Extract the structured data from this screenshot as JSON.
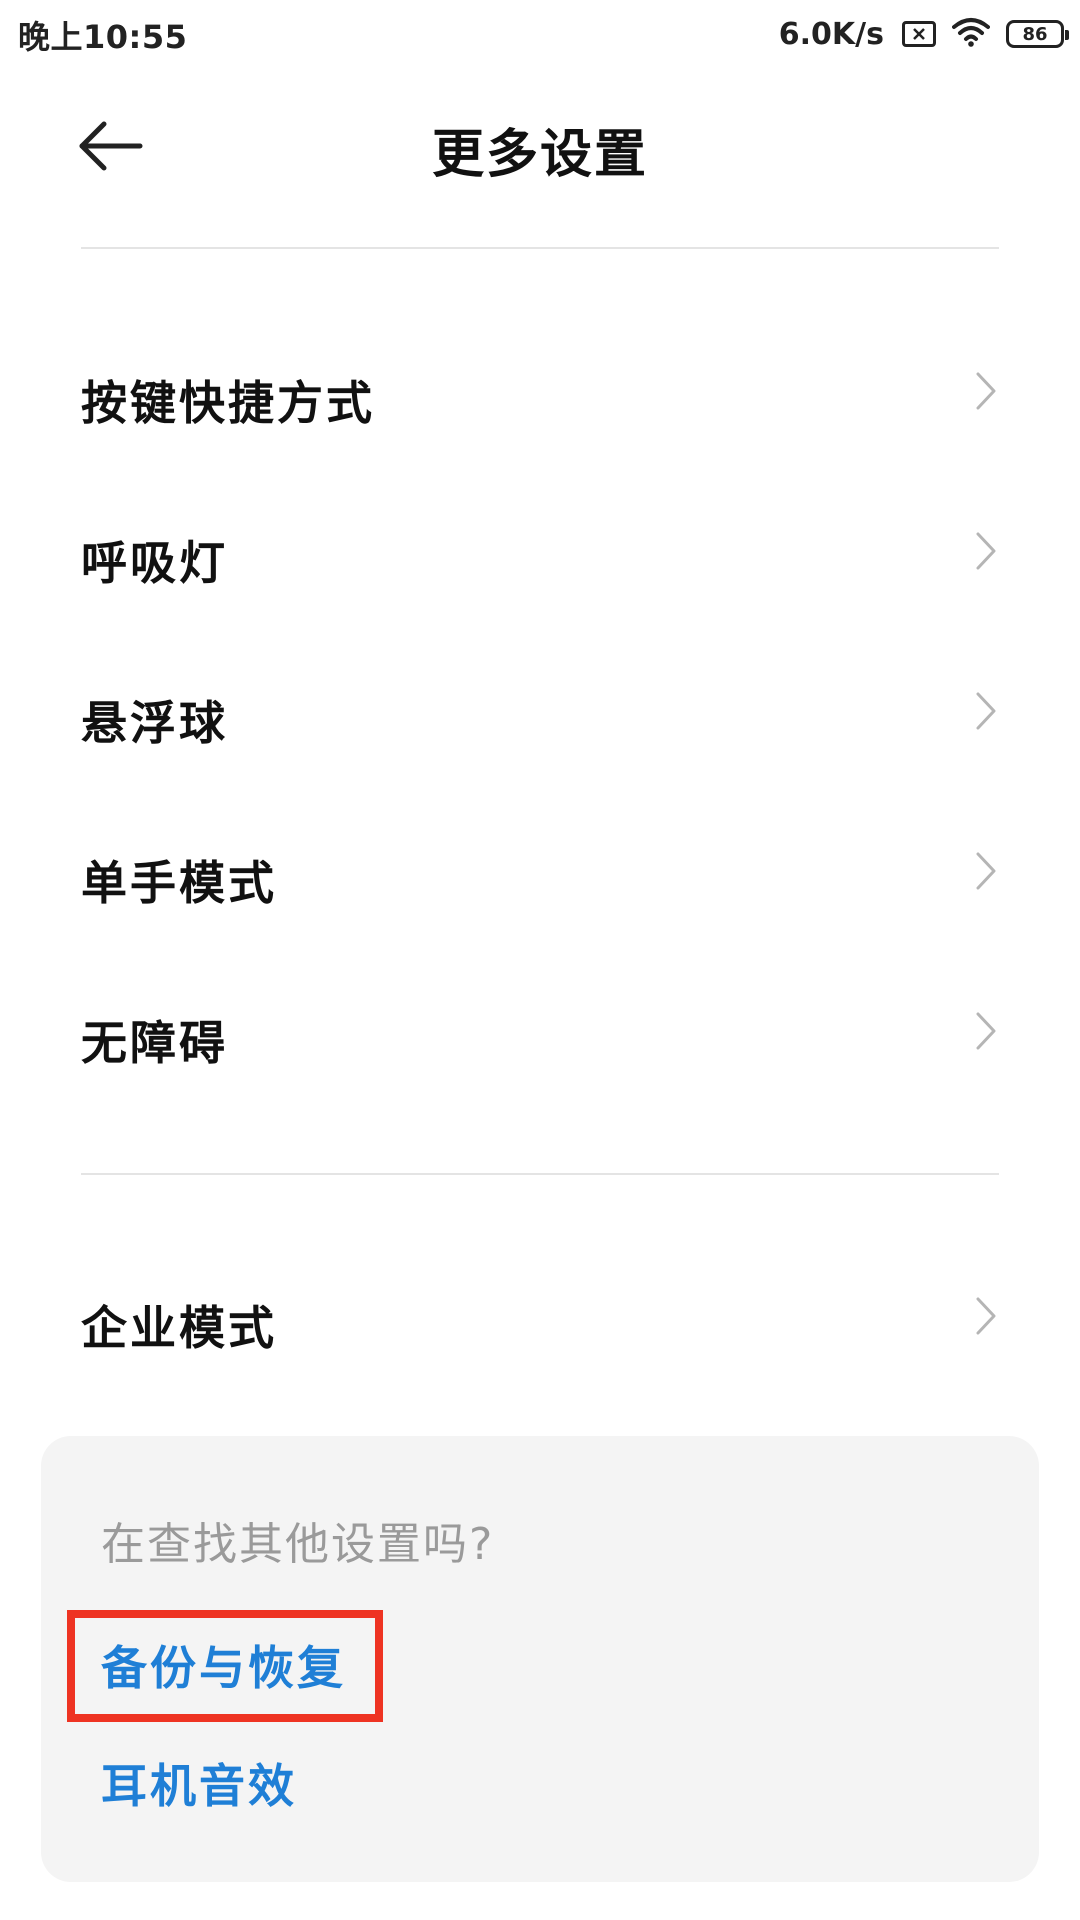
{
  "status_bar": {
    "time": "晚上10:55",
    "net_speed": "6.0K/s",
    "battery": "86",
    "icons": [
      "sim-x-icon",
      "wifi-icon",
      "battery-icon"
    ]
  },
  "header": {
    "title": "更多设置",
    "back_icon": "back-arrow-icon"
  },
  "settings": {
    "items": [
      {
        "label": "按键快捷方式"
      },
      {
        "label": "呼吸灯"
      },
      {
        "label": "悬浮球"
      },
      {
        "label": "单手模式"
      },
      {
        "label": "无障碍"
      }
    ],
    "enterprise": {
      "label": "企业模式"
    }
  },
  "suggestions": {
    "title": "在查找其他设置吗?",
    "links": [
      {
        "label": "备份与恢复",
        "highlighted": true
      },
      {
        "label": "耳机音效",
        "highlighted": false
      }
    ]
  },
  "colors": {
    "link": "#1f7fd6",
    "highlight": "#ee3322",
    "card_bg": "#f4f4f4"
  }
}
